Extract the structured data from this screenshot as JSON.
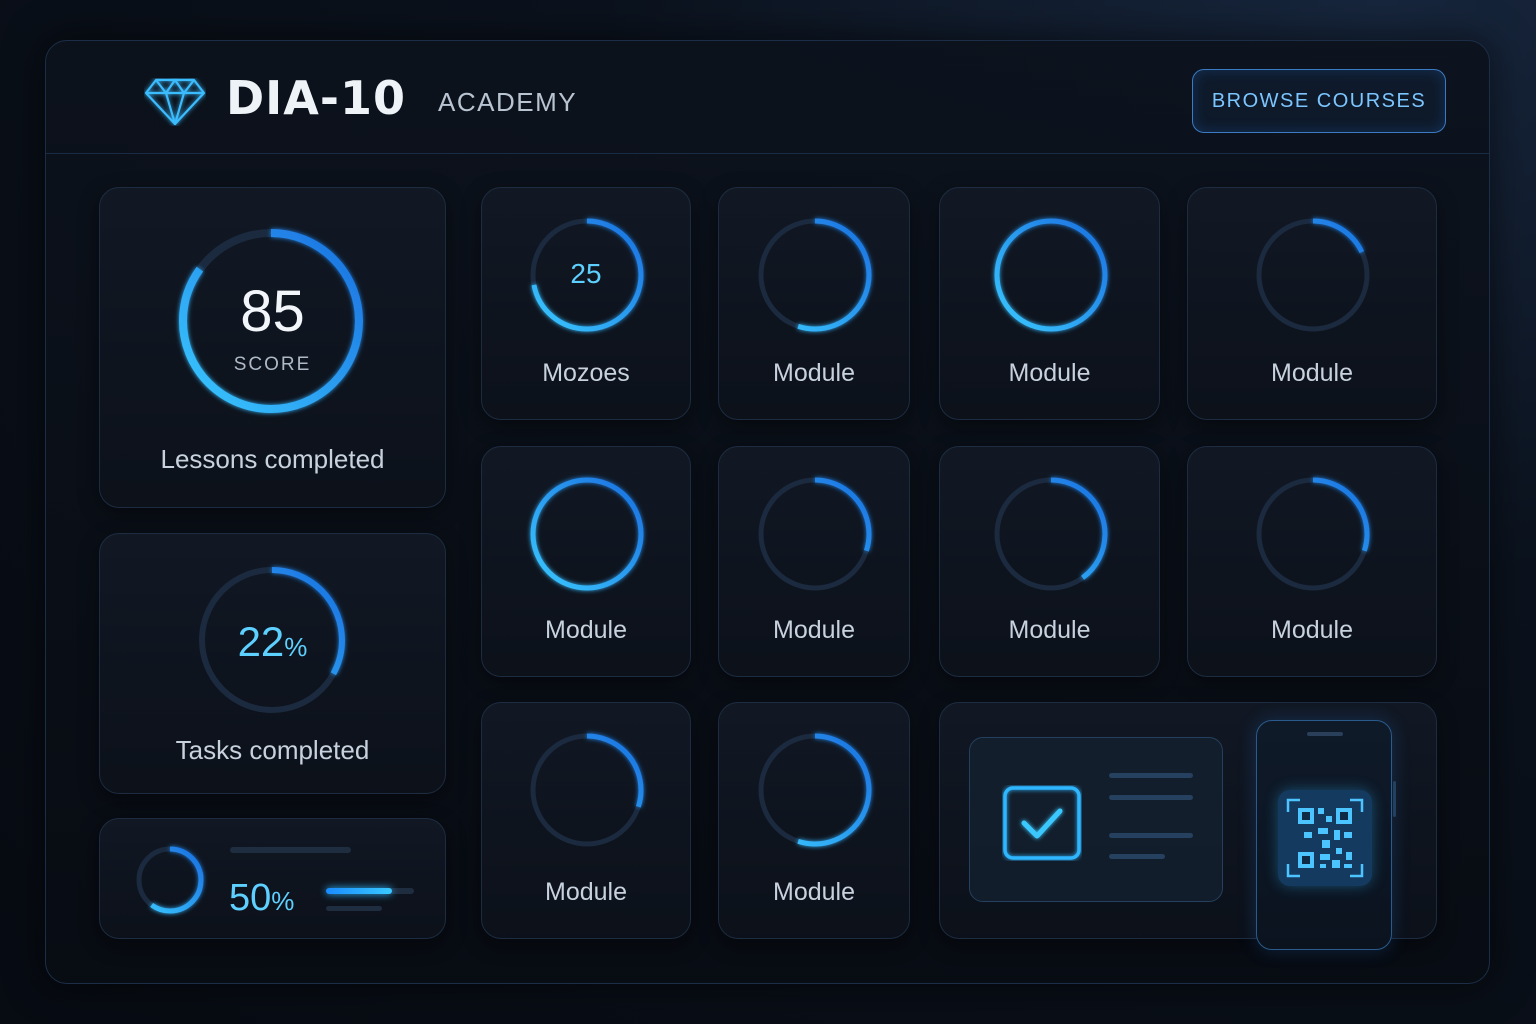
{
  "header": {
    "brand": "DIA-10",
    "subtitle": "ACADEMY",
    "browse_label": "BROWSE COURSES",
    "logo_icon": "diamond-icon"
  },
  "score_card": {
    "value": "85",
    "caption": "SCORE",
    "label": "Lessons completed",
    "progress": 0.85
  },
  "tasks_card": {
    "value": "22",
    "unit": "%",
    "label": "Tasks completed",
    "progress": 0.33
  },
  "mini_card": {
    "value": "50",
    "unit": "%",
    "progress": 0.6,
    "bar_fill": 0.75
  },
  "modules": [
    {
      "label": "Mozoes",
      "value": "25",
      "progress": 0.72
    },
    {
      "label": "Module",
      "progress": 0.55
    },
    {
      "label": "Module",
      "progress": 1.0
    },
    {
      "label": "Module",
      "progress": 0.18
    },
    {
      "label": "Module",
      "progress": 1.0
    },
    {
      "label": "Module",
      "progress": 0.3
    },
    {
      "label": "Module",
      "progress": 0.4
    },
    {
      "label": "Module",
      "progress": 0.3
    },
    {
      "label": "Module",
      "progress": 0.3
    },
    {
      "label": "Module",
      "progress": 0.55
    }
  ],
  "promo": {
    "check_icon": "checkbox-checked-icon",
    "qr_icon": "qr-code-icon",
    "phone_icon": "smartphone-icon"
  },
  "colors": {
    "accent": "#2fb6ff",
    "accent_deep": "#1a6fe0",
    "track": "#1b2a3f",
    "background": "#070b12"
  }
}
